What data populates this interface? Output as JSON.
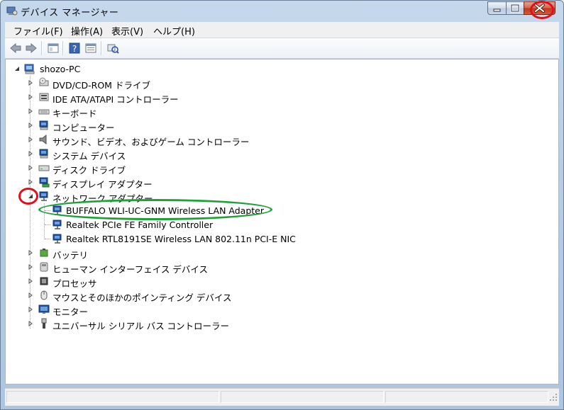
{
  "window": {
    "title": "デバイス マネージャー"
  },
  "menu": {
    "items": [
      "ファイル(F)",
      "操作(A)",
      "表示(V)",
      "ヘルプ(H)"
    ]
  },
  "toolbar": {
    "buttons": [
      "back-icon",
      "forward-icon",
      "console-tree-icon",
      "help-icon",
      "properties-icon",
      "scan-hardware-icon"
    ]
  },
  "tree": {
    "root": "shozo-PC",
    "categories": [
      {
        "label": "DVD/CD-ROM ドライブ",
        "icon": "dvd-drive-icon"
      },
      {
        "label": "IDE ATA/ATAPI コントローラー",
        "icon": "ide-controller-icon"
      },
      {
        "label": "キーボード",
        "icon": "keyboard-icon"
      },
      {
        "label": "コンピューター",
        "icon": "computer-icon"
      },
      {
        "label": "サウンド、ビデオ、およびゲーム コントローラー",
        "icon": "speaker-icon"
      },
      {
        "label": "システム デバイス",
        "icon": "system-device-icon"
      },
      {
        "label": "ディスク ドライブ",
        "icon": "disk-drive-icon"
      },
      {
        "label": "ディスプレイ アダプター",
        "icon": "display-adapter-icon"
      },
      {
        "label": "ネットワーク アダプター",
        "icon": "network-adapter-icon"
      }
    ],
    "network_children": [
      "BUFFALO WLI-UC-GNM Wireless LAN Adapter",
      "Realtek PCIe FE Family Controller",
      "Realtek RTL8191SE Wireless LAN 802.11n PCI-E NIC"
    ],
    "categories_after": [
      {
        "label": "バッテリ",
        "icon": "battery-icon"
      },
      {
        "label": "ヒューマン インターフェイス デバイス",
        "icon": "hid-icon"
      },
      {
        "label": "プロセッサ",
        "icon": "processor-icon"
      },
      {
        "label": "マウスとそのほかのポインティング デバイス",
        "icon": "mouse-icon"
      },
      {
        "label": "モニター",
        "icon": "monitor-icon"
      },
      {
        "label": "ユニバーサル シリアル バス コントローラー",
        "icon": "usb-icon"
      }
    ]
  },
  "colors": {
    "annotation_red": "#e10f1a",
    "annotation_green": "#20a038"
  }
}
